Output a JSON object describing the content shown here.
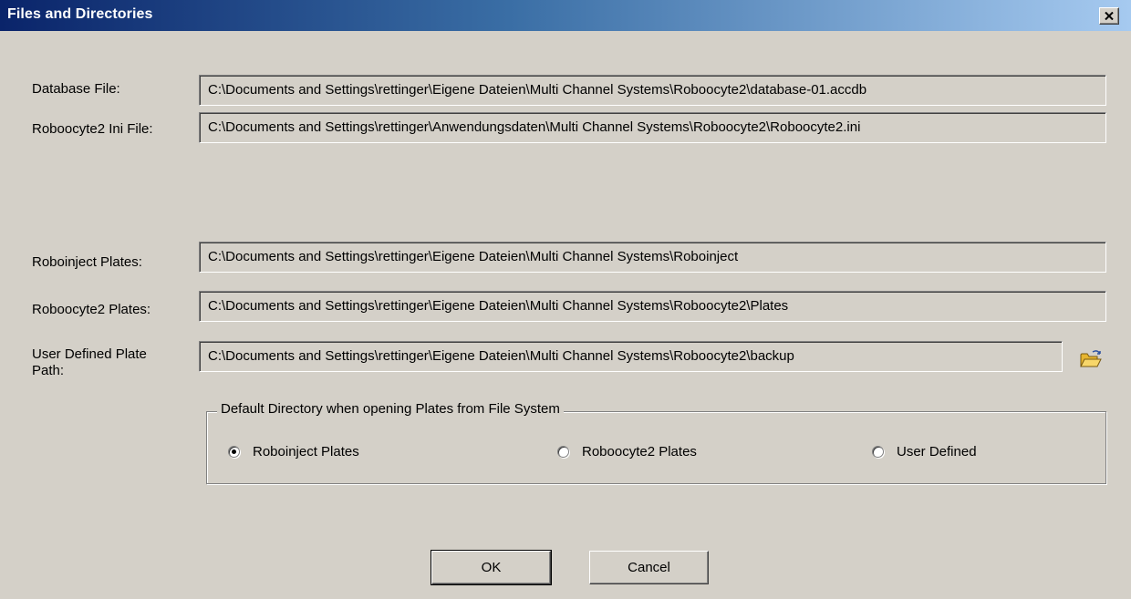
{
  "window": {
    "title": "Files and Directories"
  },
  "fields": {
    "database": {
      "label": "Database File:",
      "value": "C:\\Documents and Settings\\rettinger\\Eigene Dateien\\Multi Channel Systems\\Roboocyte2\\database-01.accdb"
    },
    "ini": {
      "label": "Roboocyte2 Ini File:",
      "value": "C:\\Documents and Settings\\rettinger\\Anwendungsdaten\\Multi Channel Systems\\Roboocyte2\\Roboocyte2.ini"
    },
    "roboinject": {
      "label": "Roboinject Plates:",
      "value": "C:\\Documents and Settings\\rettinger\\Eigene Dateien\\Multi Channel Systems\\Roboinject"
    },
    "roboocyte": {
      "label": "Roboocyte2 Plates:",
      "value": "C:\\Documents and Settings\\rettinger\\Eigene Dateien\\Multi Channel Systems\\Roboocyte2\\Plates"
    },
    "user_defined": {
      "label_line1": "User Defined Plate",
      "label_line2": "Path:",
      "value": "C:\\Documents and Settings\\rettinger\\Eigene Dateien\\Multi Channel Systems\\Roboocyte2\\backup"
    }
  },
  "default_directory": {
    "legend": "Default Directory when opening Plates from File System",
    "options": [
      {
        "label": "Roboinject Plates",
        "selected": true
      },
      {
        "label": "Roboocyte2 Plates",
        "selected": false
      },
      {
        "label": "User Defined",
        "selected": false
      }
    ]
  },
  "buttons": {
    "ok": "OK",
    "cancel": "Cancel"
  },
  "icons": {
    "close": "close-icon",
    "folder": "open-folder-icon"
  }
}
